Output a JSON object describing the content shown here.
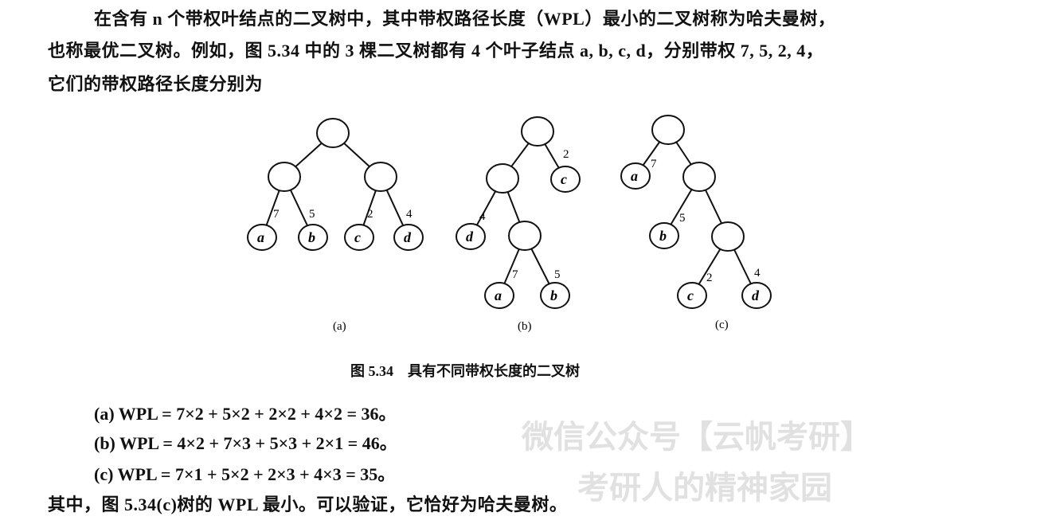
{
  "paragraph": {
    "line1": "在含有 n 个带权叶结点的二叉树中，其中带权路径长度（WPL）最小的二叉树称为哈夫曼树，",
    "line2": "也称最优二叉树。例如，图 5.34 中的 3 棵二叉树都有 4 个叶子结点 a, b, c, d，分别带权 7, 5, 2, 4，",
    "line3": "它们的带权路径长度分别为"
  },
  "figure": {
    "caption": "图 5.34　具有不同带权长度的二叉树",
    "sub_a": "(a)",
    "sub_b": "(b)",
    "sub_c": "(c)",
    "leaf_labels": {
      "a": "a",
      "b": "b",
      "c": "c",
      "d": "d"
    },
    "weights": {
      "a": "7",
      "b": "5",
      "c": "2",
      "d": "4"
    }
  },
  "formulas": {
    "a": "(a) WPL = 7×2 + 5×2 + 2×2 + 4×2 = 36。",
    "b": "(b) WPL = 4×2 + 7×3 + 5×3 + 2×1 = 46。",
    "c": "(c) WPL = 7×1 + 5×2 + 2×3 + 4×3 = 35。"
  },
  "conclusion": "其中，图 5.34(c)树的 WPL 最小。可以验证，它恰好为哈夫曼树。",
  "watermark": {
    "line1": "微信公众号【云帆考研】",
    "line2": "考研人的精神家园"
  }
}
